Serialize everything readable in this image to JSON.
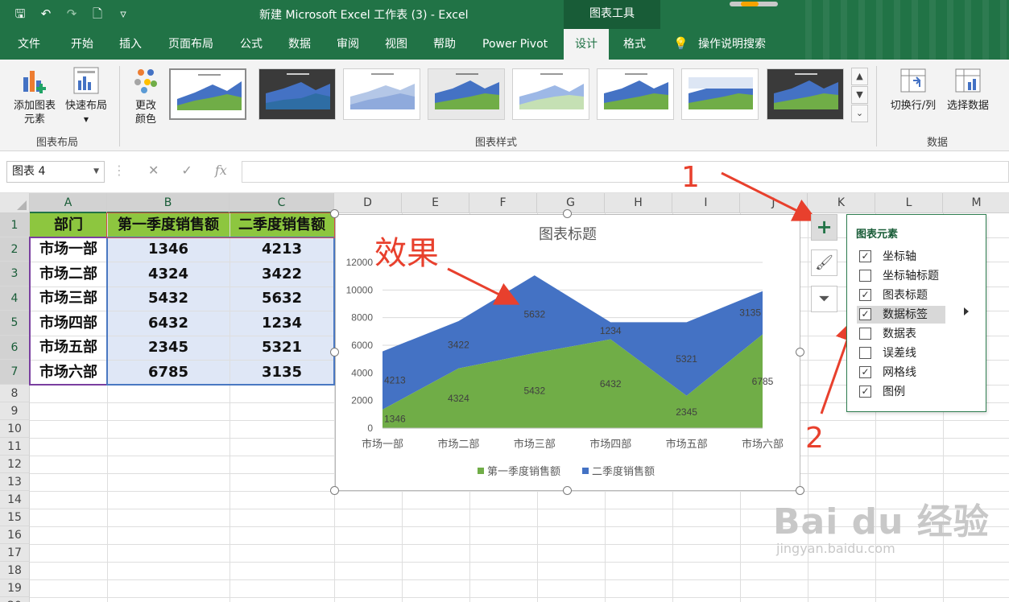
{
  "titlebar": {
    "doc_title": "新建 Microsoft Excel 工作表 (3)  -  Excel",
    "tool_tab": "图表工具"
  },
  "menu": {
    "tabs": [
      "文件",
      "开始",
      "插入",
      "页面布局",
      "公式",
      "数据",
      "审阅",
      "视图",
      "帮助",
      "Power Pivot",
      "设计",
      "格式"
    ],
    "active": "设计",
    "search_tip": "操作说明搜索"
  },
  "ribbon": {
    "add_element": "添加图表",
    "add_element_2": "元素",
    "quick_layout": "快速布局",
    "change_color": "更改",
    "change_color_2": "颜色",
    "group_layout": "图表布局",
    "group_styles": "图表样式",
    "switch_row_col": "切换行/列",
    "select_data": "选择数据",
    "group_data": "数据"
  },
  "formula_bar": {
    "name_box": "图表 4",
    "cancel": "✕",
    "enter": "✓",
    "fx": "fx",
    "value": ""
  },
  "sheet": {
    "columns": [
      "A",
      "B",
      "C",
      "D",
      "E",
      "F",
      "G",
      "H",
      "I",
      "J",
      "K",
      "L",
      "M"
    ],
    "rows": [
      "1",
      "2",
      "3",
      "4",
      "5",
      "6",
      "7",
      "8",
      "9",
      "10",
      "11",
      "12",
      "13",
      "14",
      "15",
      "16",
      "17",
      "18",
      "19",
      "20"
    ],
    "header": [
      "部门",
      "第一季度销售额",
      "二季度销售额"
    ],
    "data": [
      [
        "市场一部",
        "1346",
        "4213"
      ],
      [
        "市场二部",
        "4324",
        "3422"
      ],
      [
        "市场三部",
        "5432",
        "5632"
      ],
      [
        "市场四部",
        "6432",
        "1234"
      ],
      [
        "市场五部",
        "2345",
        "5321"
      ],
      [
        "市场六部",
        "6785",
        "3135"
      ]
    ]
  },
  "chart_data": {
    "type": "area",
    "stacked": true,
    "title": "图表标题",
    "categories": [
      "市场一部",
      "市场二部",
      "市场三部",
      "市场四部",
      "市场五部",
      "市场六部"
    ],
    "series": [
      {
        "name": "第一季度销售额",
        "values": [
          1346,
          4324,
          5432,
          6432,
          2345,
          6785
        ],
        "color": "#70ad47"
      },
      {
        "name": "二季度销售额",
        "values": [
          4213,
          3422,
          5632,
          1234,
          5321,
          3135
        ],
        "color": "#4472c4"
      }
    ],
    "ylim": [
      0,
      12000
    ],
    "yticks": [
      0,
      2000,
      4000,
      6000,
      8000,
      10000,
      12000
    ],
    "grid": true,
    "legend": "bottom",
    "data_labels": true
  },
  "chart_elements": {
    "title": "图表元素",
    "items": [
      {
        "label": "坐标轴",
        "checked": true
      },
      {
        "label": "坐标轴标题",
        "checked": false
      },
      {
        "label": "图表标题",
        "checked": true
      },
      {
        "label": "数据标签",
        "checked": true
      },
      {
        "label": "数据表",
        "checked": false
      },
      {
        "label": "误差线",
        "checked": false
      },
      {
        "label": "网格线",
        "checked": true
      },
      {
        "label": "图例",
        "checked": true
      }
    ]
  },
  "annotations": {
    "effect": "效果",
    "step1": "1",
    "step2": "2"
  },
  "watermark": {
    "main": "Bai du 经验",
    "sub": "jingyan.baidu.com"
  },
  "colors": {
    "excel_green": "#217346",
    "header_fill": "#8dc63f",
    "annotation": "#e8402d"
  }
}
